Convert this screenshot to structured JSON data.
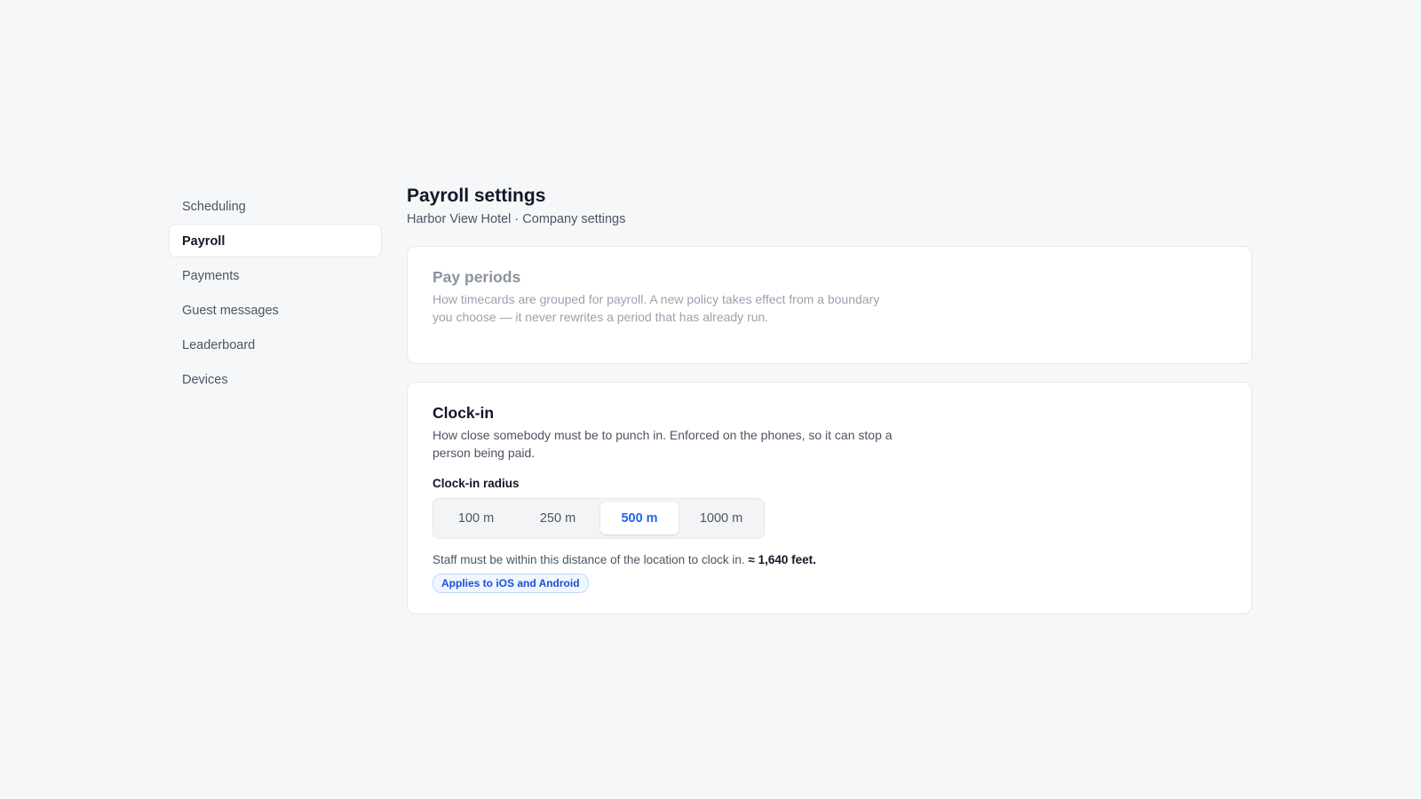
{
  "sidebar": {
    "items": [
      {
        "label": "Scheduling",
        "active": false
      },
      {
        "label": "Payroll",
        "active": true
      },
      {
        "label": "Payments",
        "active": false
      },
      {
        "label": "Guest messages",
        "active": false
      },
      {
        "label": "Leaderboard",
        "active": false
      },
      {
        "label": "Devices",
        "active": false
      }
    ]
  },
  "header": {
    "title": "Payroll settings",
    "subtitle": "Harbor View Hotel · Company settings"
  },
  "pay_periods": {
    "title": "Pay periods",
    "description": "How timecards are grouped for payroll. A new policy takes effect from a boundary you choose — it never rewrites a period that has already run."
  },
  "clock_in": {
    "title": "Clock-in",
    "description": "How close somebody must be to punch in. Enforced on the phones, so it can stop a person being paid.",
    "radius_label": "Clock-in radius",
    "options": [
      "100 m",
      "250 m",
      "500 m",
      "1000 m"
    ],
    "selected": "500 m",
    "helper_text": "Staff must be within this distance of the location to clock in.",
    "helper_emphasis": "≈ 1,640 feet.",
    "badge": "Applies to iOS and Android"
  },
  "colors": {
    "accent": "#2563eb",
    "background": "#f6f7f9"
  }
}
